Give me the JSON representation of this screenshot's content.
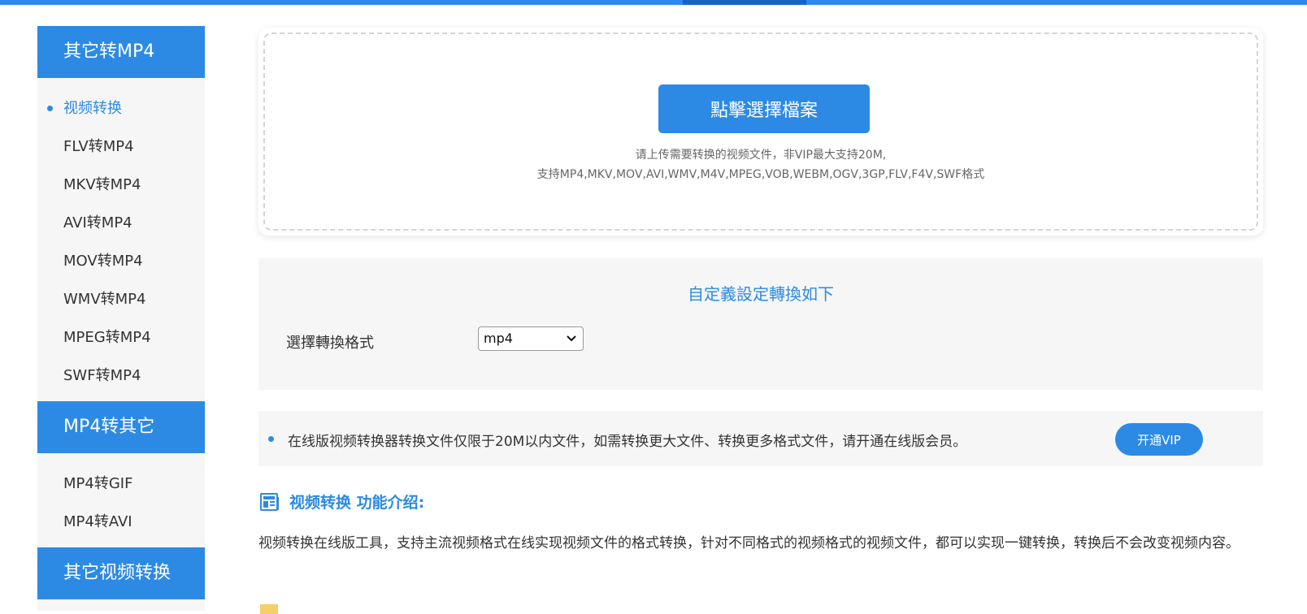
{
  "colors": {
    "accent": "#2c8ae4",
    "panel_bg": "#f6f6f6",
    "text": "#333333",
    "muted": "#666666"
  },
  "sidebar": {
    "sections": [
      {
        "title": "其它转MP4",
        "items": [
          {
            "label": "视频转换",
            "active": true
          },
          {
            "label": "FLV转MP4"
          },
          {
            "label": "MKV转MP4"
          },
          {
            "label": "AVI转MP4"
          },
          {
            "label": "MOV转MP4"
          },
          {
            "label": "WMV转MP4"
          },
          {
            "label": "MPEG转MP4"
          },
          {
            "label": "SWF转MP4"
          }
        ]
      },
      {
        "title": "MP4转其它",
        "items": [
          {
            "label": "MP4转GIF"
          },
          {
            "label": "MP4转AVI"
          }
        ]
      },
      {
        "title": "其它视频转换",
        "items": []
      }
    ]
  },
  "upload": {
    "button_label": "點擊選擇檔案",
    "note_line1": "请上传需要转换的视频文件，非VIP最大支持20M,",
    "note_line2": "支持MP4,MKV,MOV,AVI,WMV,M4V,MPEG,VOB,WEBM,OGV,3GP,FLV,F4V,SWF格式"
  },
  "settings": {
    "title": "自定義設定轉換如下",
    "format_label": "選擇轉換格式",
    "format_selected": "mp4"
  },
  "notice": {
    "text": "在线版视频转换器转换文件仅限于20M以内文件，如需转换更大文件、转换更多格式文件，请开通在线版会员。",
    "vip_button_label": "开通VIP"
  },
  "intro": {
    "icon": "news-icon",
    "title": "视频转换 功能介绍:",
    "description": "视频转换在线版工具，支持主流视频格式在线实现视频文件的格式转换，针对不同格式的视频格式的视频文件，都可以实现一键转换，转换后不会改变视频内容。"
  }
}
